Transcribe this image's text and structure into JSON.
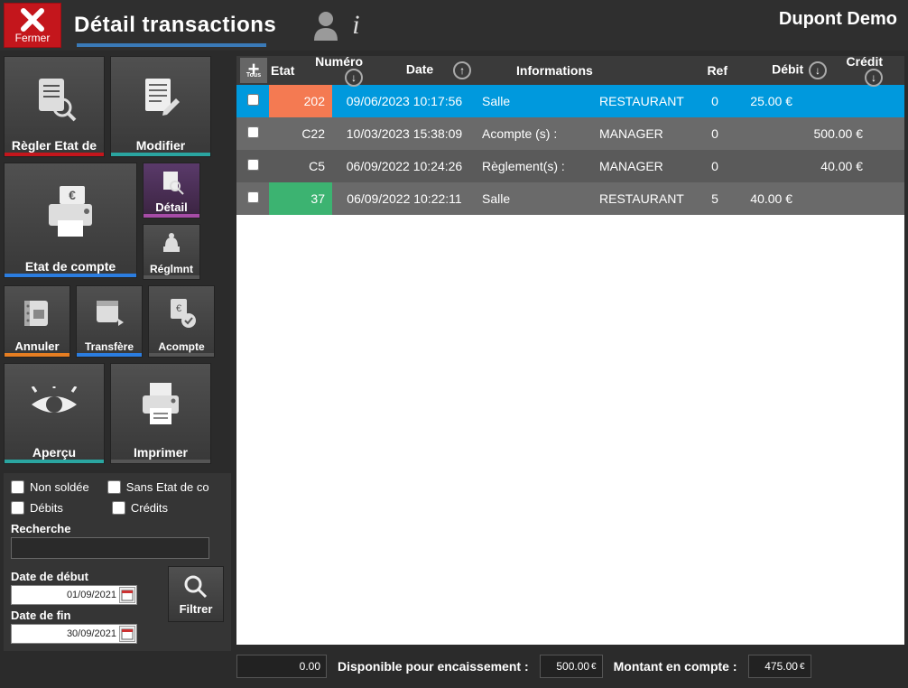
{
  "header": {
    "close": "Fermer",
    "title": "Détail transactions",
    "user": "Dupont Demo"
  },
  "buttons": {
    "regler": "Règler Etat de",
    "modifier": "Modifier",
    "etat": "Etat de compte",
    "detail": "Détail",
    "reglmnt": "Réglmnt",
    "annuler": "Annuler",
    "transfere": "Transfère",
    "acompte": "Acompte",
    "apercu": "Aperçu",
    "imprimer": "Imprimer"
  },
  "filters": {
    "non_soldee": "Non soldée",
    "sans_etat": "Sans Etat de co",
    "debits": "Débits",
    "credits": "Crédits",
    "recherche": "Recherche",
    "date_debut": "Date de début",
    "date_fin": "Date de fin",
    "date_debut_val": "01/09/2021",
    "date_fin_val": "30/09/2021",
    "filtrer": "Filtrer"
  },
  "table": {
    "headers": {
      "tous": "Tous",
      "etat": "Etat",
      "numero": "Numéro",
      "date": "Date",
      "informations": "Informations",
      "ref": "Ref",
      "debit": "Débit",
      "credit": "Crédit"
    },
    "rows": [
      {
        "num": "202",
        "date": "09/06/2023 10:17:56",
        "info": "Salle",
        "ref": "RESTAURANT",
        "bal": "0",
        "debit": "25.00 €",
        "credit": "",
        "row_class": "r-blue",
        "num_class": "num-orange"
      },
      {
        "num": "C22",
        "date": "10/03/2023 15:38:09",
        "info": "Acompte (s) :",
        "ref": "MANAGER",
        "bal": "0",
        "debit": "",
        "credit": "500.00  €",
        "row_class": "r-gray1",
        "num_class": ""
      },
      {
        "num": "C5",
        "date": "06/09/2022 10:24:26",
        "info": "Règlement(s) :",
        "ref": "MANAGER",
        "bal": "0",
        "debit": "",
        "credit": "40.00  €",
        "row_class": "r-gray2",
        "num_class": ""
      },
      {
        "num": "37",
        "date": "06/09/2022 10:22:11",
        "info": "Salle",
        "ref": "RESTAURANT",
        "bal": "5",
        "debit": "40.00 €",
        "credit": "",
        "row_class": "r-gray1",
        "num_class": "num-green"
      }
    ]
  },
  "footer": {
    "val0": "0.00",
    "disp_label": "Disponible pour encaissement :",
    "disp_val": "500.00",
    "compte_label": "Montant en compte :",
    "compte_val": "475.00",
    "eur": "€"
  }
}
